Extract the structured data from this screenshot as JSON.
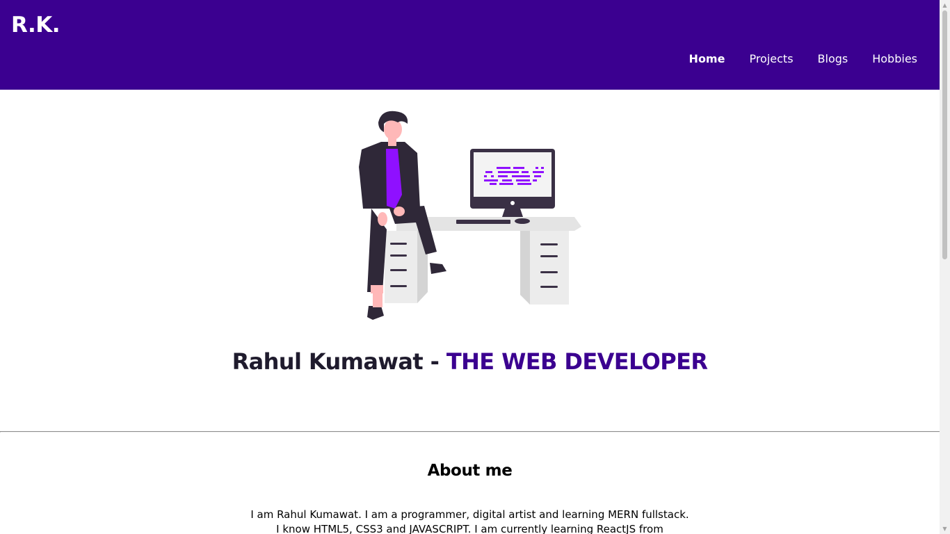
{
  "header": {
    "brand": "R.K.",
    "nav": [
      {
        "label": "Home",
        "active": true
      },
      {
        "label": "Projects",
        "active": false
      },
      {
        "label": "Blogs",
        "active": false
      },
      {
        "label": "Hobbies",
        "active": false
      }
    ]
  },
  "hero": {
    "illustration": "developer-at-desk-illustration",
    "title_name": "Rahul Kumawat -",
    "title_role": "THE WEB DEVELOPER"
  },
  "about": {
    "heading": "About me",
    "line1": "I am Rahul Kumawat. I am a programmer, digital artist and learning MERN fullstack.",
    "line2": "I know HTML5, CSS3 and JAVASCRIPT. I am currently learning ReactJS from"
  },
  "colors": {
    "header_bg": "#3b0090",
    "accent": "#3b0090",
    "shirt": "#8f10ff",
    "desk": "#e2e2e2",
    "dark": "#2f2838"
  }
}
